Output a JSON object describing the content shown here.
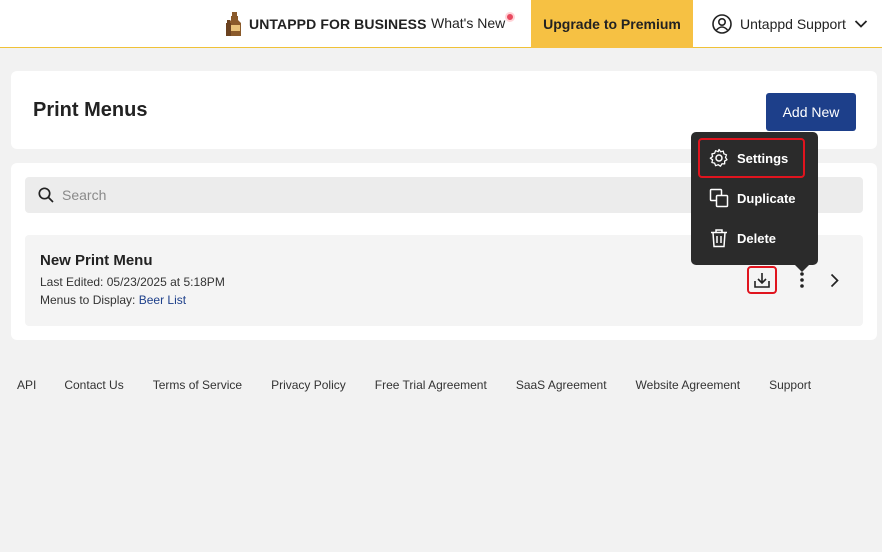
{
  "topbar": {
    "brand": "UNTAPPD FOR BUSINESS",
    "whats_new": "What's New",
    "upgrade": "Upgrade to Premium",
    "account": "Untappd Support"
  },
  "header": {
    "title": "Print Menus",
    "add_new": "Add New"
  },
  "search": {
    "placeholder": "Search"
  },
  "menus": [
    {
      "name": "New Print Menu",
      "last_edited_label": "Last Edited:",
      "last_edited_value": "05/23/2025 at 5:18PM",
      "display_label": "Menus to Display:",
      "display_value": "Beer List"
    }
  ],
  "dropdown": {
    "settings": "Settings",
    "duplicate": "Duplicate",
    "delete": "Delete"
  },
  "footer": {
    "links": [
      "API",
      "Contact Us",
      "Terms of Service",
      "Privacy Policy",
      "Free Trial Agreement",
      "SaaS Agreement",
      "Website Agreement",
      "Support"
    ]
  },
  "colors": {
    "brand_blue": "#1d3f8a",
    "premium_yellow": "#f6c143",
    "highlight_red": "#e0141e",
    "menu_dark": "#2b2b2b"
  }
}
